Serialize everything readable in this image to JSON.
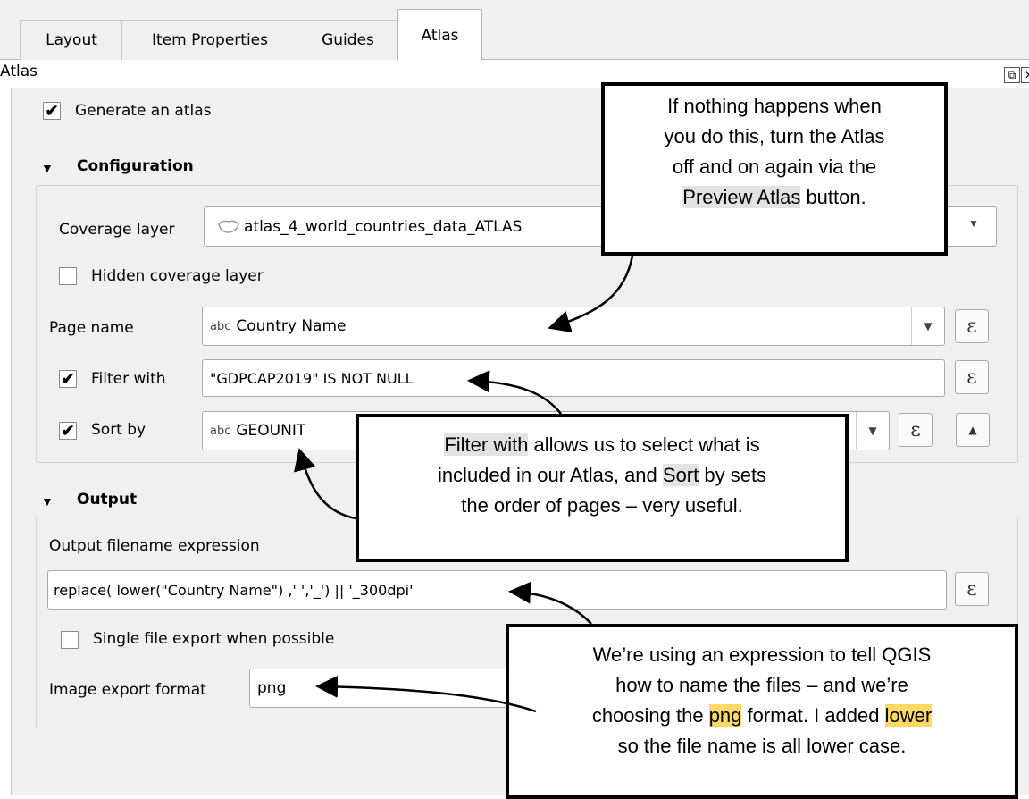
{
  "tabs": [
    "Layout",
    "Item Properties",
    "Guides",
    "Atlas"
  ],
  "panel": {
    "title": "Atlas",
    "float_btn": "⧉",
    "close_btn": "✕"
  },
  "generate": {
    "label": "Generate an atlas",
    "checked": "✔"
  },
  "configuration": {
    "title": "Configuration",
    "coverage_label": "Coverage layer",
    "coverage_value": "atlas_4_world_countries_data_ATLAS",
    "hidden_label": "Hidden coverage layer",
    "page_name_label": "Page name",
    "page_name_value": "Country Name",
    "filter_label": "Filter with",
    "filter_value": "\"GDPCAP2019\" IS NOT NULL",
    "sort_label": "Sort by",
    "sort_value": "GEOUNIT",
    "abc": "abc",
    "expr_symbol": "ε",
    "check_mark": "✔"
  },
  "output": {
    "title": "Output",
    "filename_label": "Output filename expression",
    "filename_value": "replace( lower(\"Country Name\") ,' ','_') || '_300dpi'",
    "single_file_label": "Single file export when possible",
    "format_label": "Image export format",
    "format_value": "png"
  },
  "callouts": {
    "one": {
      "line1": "If nothing happens when",
      "line2": "you do this, turn the Atlas",
      "line3": "off and on again via the",
      "hl": "Preview Atlas",
      "tail": " button."
    },
    "two": {
      "hl1": "Filter with",
      "rest1": " allows us to select what is",
      "line2a": "included in our Atlas, and ",
      "hl2": "Sort",
      "line2b": " by sets",
      "line3": "the order of pages – very useful."
    },
    "three": {
      "line1": "We’re using an expression to tell QGIS",
      "line2": "how to name the files – and we’re",
      "line3a": "choosing the ",
      "hl1": "png",
      "line3b": " format. I added ",
      "hl2": "lower",
      "line4": "so the file name is all lower case."
    }
  }
}
